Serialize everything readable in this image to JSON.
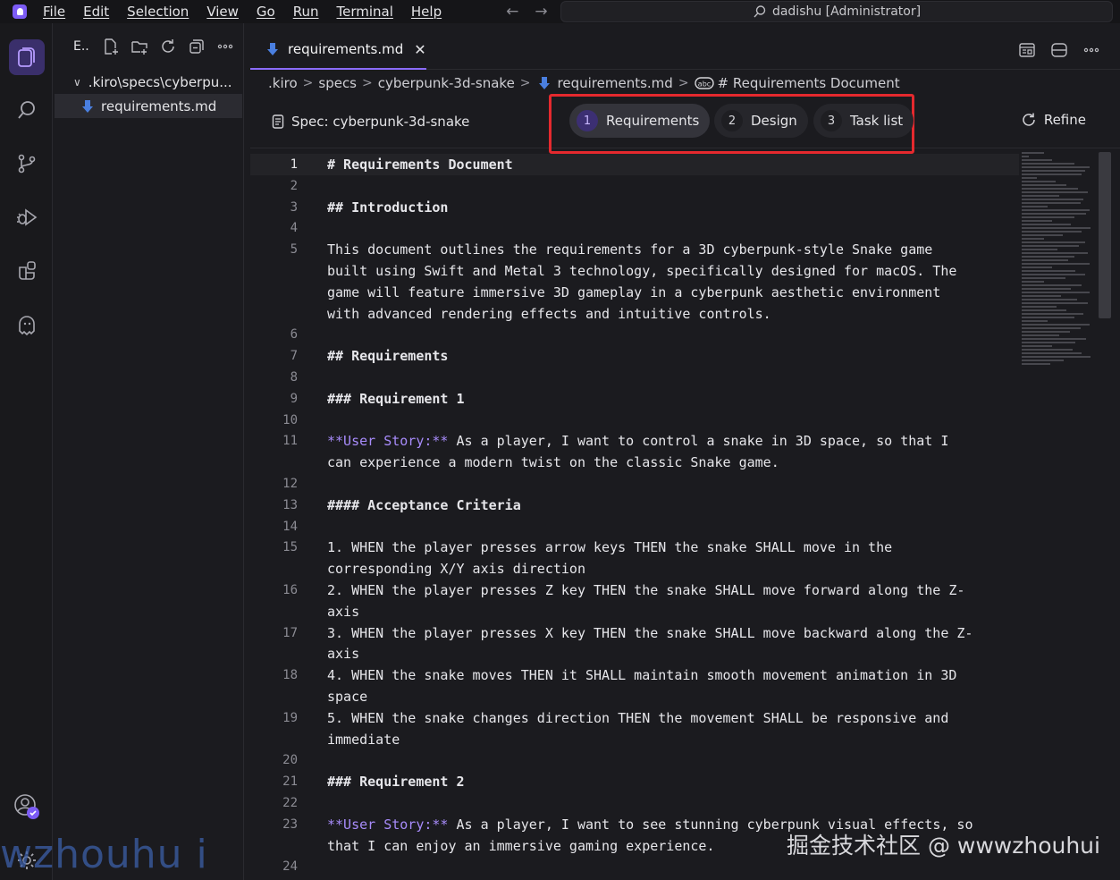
{
  "menu": [
    "File",
    "Edit",
    "Selection",
    "View",
    "Go",
    "Run",
    "Terminal",
    "Help"
  ],
  "window_title": "dadishu [Administrator]",
  "sidebar": {
    "header": "E..",
    "tree": [
      {
        "label": ".kiro\\specs\\cyberpu...",
        "selected": false
      },
      {
        "label": "requirements.md",
        "selected": true
      }
    ]
  },
  "editor_tab": {
    "label": "requirements.md",
    "close": "✕"
  },
  "breadcrumb": [
    ".kiro",
    "specs",
    "cyberpunk-3d-snake",
    "requirements.md",
    "# Requirements Document"
  ],
  "spec": {
    "title": "Spec: cyberpunk-3d-snake",
    "steps": [
      {
        "num": "1",
        "label": "Requirements",
        "active": true
      },
      {
        "num": "2",
        "label": "Design",
        "active": false
      },
      {
        "num": "3",
        "label": "Task list",
        "active": false
      }
    ],
    "refine": "Refine"
  },
  "code_lines": [
    {
      "n": "1",
      "parts": [
        [
          "hd",
          "# Requirements Document"
        ]
      ]
    },
    {
      "n": "2",
      "parts": []
    },
    {
      "n": "3",
      "parts": [
        [
          "hd",
          "## Introduction"
        ]
      ]
    },
    {
      "n": "4",
      "parts": []
    },
    {
      "n": "5",
      "parts": [
        [
          "",
          "This document outlines the requirements for a 3D cyberpunk-style Snake game"
        ]
      ]
    },
    {
      "n": "",
      "parts": [
        [
          "",
          "built using Swift and Metal 3 technology, specifically designed for macOS. The"
        ]
      ]
    },
    {
      "n": "",
      "parts": [
        [
          "",
          "game will feature immersive 3D gameplay in a cyberpunk aesthetic environment"
        ]
      ]
    },
    {
      "n": "",
      "parts": [
        [
          "",
          "with advanced rendering effects and intuitive controls."
        ]
      ]
    },
    {
      "n": "6",
      "parts": []
    },
    {
      "n": "7",
      "parts": [
        [
          "hd",
          "## Requirements"
        ]
      ]
    },
    {
      "n": "8",
      "parts": []
    },
    {
      "n": "9",
      "parts": [
        [
          "hd",
          "### Requirement 1"
        ]
      ]
    },
    {
      "n": "10",
      "parts": []
    },
    {
      "n": "11",
      "parts": [
        [
          "purple",
          "**User Story:**"
        ],
        [
          "",
          " As a player, I want to control a snake in 3D space, so that I"
        ]
      ]
    },
    {
      "n": "",
      "parts": [
        [
          "",
          "can experience a modern twist on the classic Snake game."
        ]
      ]
    },
    {
      "n": "12",
      "parts": []
    },
    {
      "n": "13",
      "parts": [
        [
          "hd",
          "#### Acceptance Criteria"
        ]
      ]
    },
    {
      "n": "14",
      "parts": []
    },
    {
      "n": "15",
      "parts": [
        [
          "",
          "1. WHEN the player presses arrow keys THEN the snake SHALL move in the"
        ]
      ]
    },
    {
      "n": "",
      "parts": [
        [
          "",
          "corresponding X/Y axis direction"
        ]
      ]
    },
    {
      "n": "16",
      "parts": [
        [
          "",
          "2. WHEN the player presses Z key THEN the snake SHALL move forward along the Z-"
        ]
      ]
    },
    {
      "n": "",
      "parts": [
        [
          "",
          "axis"
        ]
      ]
    },
    {
      "n": "17",
      "parts": [
        [
          "",
          "3. WHEN the player presses X key THEN the snake SHALL move backward along the Z-"
        ]
      ]
    },
    {
      "n": "",
      "parts": [
        [
          "",
          "axis"
        ]
      ]
    },
    {
      "n": "18",
      "parts": [
        [
          "",
          "4. WHEN the snake moves THEN it SHALL maintain smooth movement animation in 3D"
        ]
      ]
    },
    {
      "n": "",
      "parts": [
        [
          "",
          "space"
        ]
      ]
    },
    {
      "n": "19",
      "parts": [
        [
          "",
          "5. WHEN the snake changes direction THEN the movement SHALL be responsive and"
        ]
      ]
    },
    {
      "n": "",
      "parts": [
        [
          "",
          "immediate"
        ]
      ]
    },
    {
      "n": "20",
      "parts": []
    },
    {
      "n": "21",
      "parts": [
        [
          "hd",
          "### Requirement 2"
        ]
      ]
    },
    {
      "n": "22",
      "parts": []
    },
    {
      "n": "23",
      "parts": [
        [
          "purple",
          "**User Story:**"
        ],
        [
          "",
          " As a player, I want to see stunning cyberpunk visual effects, so"
        ]
      ]
    },
    {
      "n": "",
      "parts": [
        [
          "",
          "that I can enjoy an immersive gaming experience."
        ]
      ]
    },
    {
      "n": "24",
      "parts": []
    }
  ],
  "watermark_left": "wzhouhu i",
  "watermark_right": "掘金技术社区 @ wwwzhouhui",
  "colors": {
    "accent": "#8b6cff",
    "highlight_box": "#e5292e",
    "markdown_bold": "#a78bfa"
  },
  "icons": [
    "kiro-logo-icon",
    "search-icon",
    "source-control-icon",
    "run-debug-icon",
    "extensions-icon",
    "kiro-ghost-icon",
    "account-icon",
    "settings-gear-icon"
  ]
}
